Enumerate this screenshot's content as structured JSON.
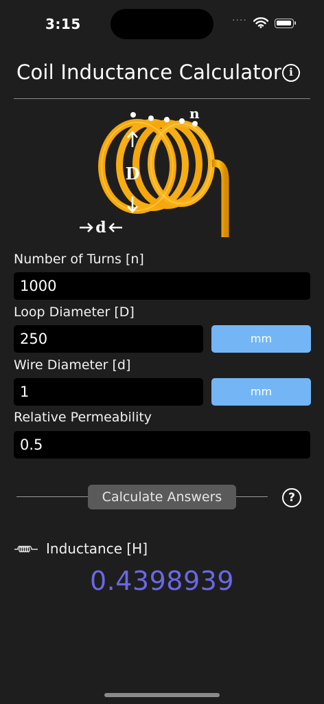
{
  "status_bar": {
    "time": "3:15",
    "signal": "····"
  },
  "header": {
    "title": "Coil Inductance Calculator",
    "info_glyph": "i"
  },
  "diagram": {
    "turns_letter": "n",
    "diameter_letter": "D",
    "wire_letter": "d",
    "coil_color": "#f5a70c"
  },
  "fields": {
    "turns": {
      "label": "Number of Turns [n]",
      "value": "1000"
    },
    "loop_diameter": {
      "label": "Loop Diameter [D]",
      "value": "250",
      "unit": "mm"
    },
    "wire_diameter": {
      "label": "Wire Diameter [d]",
      "value": "1",
      "unit": "mm"
    },
    "permeability": {
      "label": "Relative Permeability",
      "value": "0.5"
    }
  },
  "actions": {
    "calculate_label": "Calculate Answers",
    "help_glyph": "?"
  },
  "result": {
    "label": "Inductance [H]",
    "value": "0.4398939",
    "value_color": "#6b68e6"
  },
  "theme": {
    "background": "#1e1e1e",
    "field_bg": "#000000",
    "unit_button_bg": "#74b6f5",
    "button_bg": "#5a5a5a"
  }
}
